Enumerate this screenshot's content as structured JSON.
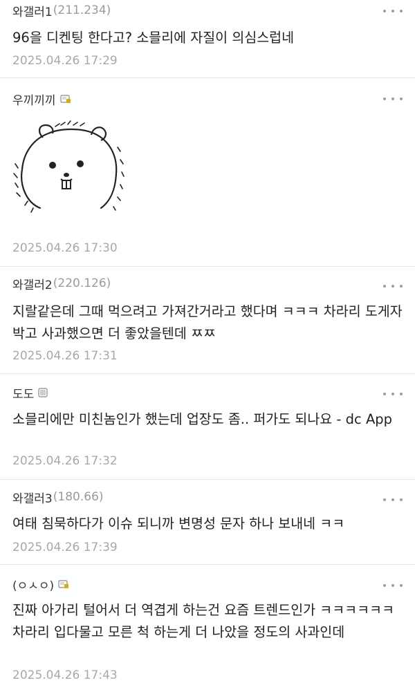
{
  "comments": [
    {
      "author": "와갤러1",
      "ip": "(211.234)",
      "text": "96을 디켄팅 한다고? 소믈리에 자질이 의심스럽네",
      "time": "2025.04.26 17:29"
    },
    {
      "author": "우끼끼끼",
      "ip": "",
      "badge": "fixed-nick-badge-icon",
      "sticker": "hamster-sticker",
      "time": "2025.04.26 17:30"
    },
    {
      "author": "와갤러2",
      "ip": "(220.126)",
      "text": "지랄같은데 그때 먹으려고 가져간거라고 했다며 ㅋㅋㅋ 차라리 도게자박고 사과했으면 더 좋았을텐데 ㅉㅉ",
      "time": "2025.04.26 17:31"
    },
    {
      "author": "도도",
      "ip": "",
      "badge": "semi-fixed-nick-badge-icon",
      "text": "소믈리에만 미친놈인가 했는데 업장도 좀.. 퍼가도 되나요 - dc App",
      "time": "2025.04.26 17:32"
    },
    {
      "author": "와갤러3",
      "ip": "(180.66)",
      "text": "여태 침묵하다가 이슈 되니까 변명성 문자 하나 보내네 ㅋㅋ",
      "time": "2025.04.26 17:39"
    },
    {
      "author": "(ㅇㅅㅇ)",
      "ip": "",
      "badge": "fixed-nick-badge-icon",
      "text": "진짜 아가리 털어서 더 역겹게 하는건 요즘 트렌드인가 ㅋㅋㅋㅋㅋㅋ\n차라리 입다물고 모른 척 하는게 더 나았을 정도의 사과인데",
      "time": "2025.04.26 17:43"
    }
  ],
  "more_icon": "more-dots-icon",
  "colors": {
    "author": "#333333",
    "ip": "#9a9a9a",
    "time": "#a8a8a8",
    "divider": "#e6e6e6",
    "badge_fixed": "#c9a400",
    "badge_semi": "#9a9a9a"
  }
}
